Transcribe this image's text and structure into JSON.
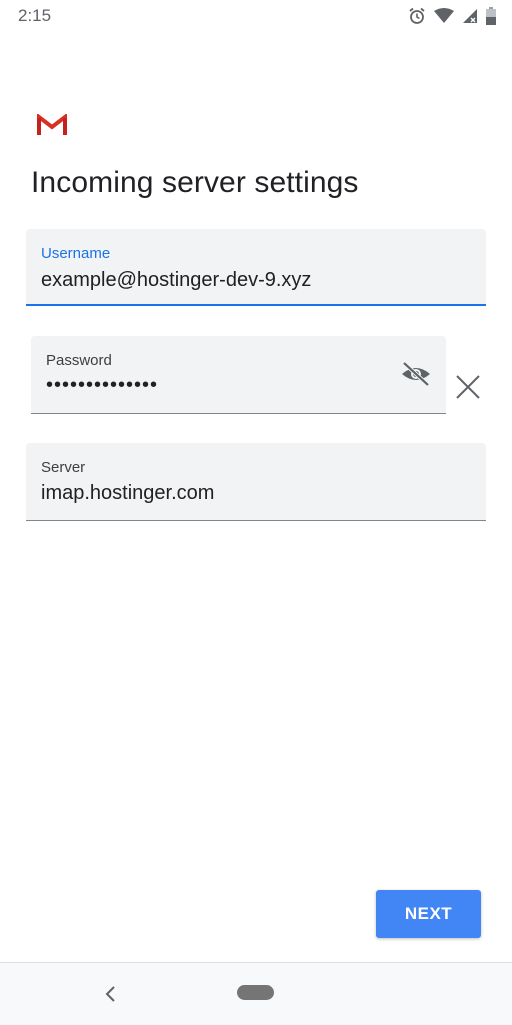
{
  "status_bar": {
    "time": "2:15",
    "icons": [
      "alarm-icon",
      "wifi-icon",
      "signal-icon",
      "battery-icon"
    ]
  },
  "app": {
    "logo_icon": "gmail-logo",
    "title": "Incoming server settings"
  },
  "form": {
    "username": {
      "label": "Username",
      "value": "example@hostinger-dev-9.xyz"
    },
    "password": {
      "label": "Password",
      "value": "••••••••••••••",
      "toggle_icon": "visibility-off-icon"
    },
    "server": {
      "label": "Server",
      "value": "imap.hostinger.com"
    }
  },
  "actions": {
    "next_label": "NEXT"
  },
  "colors": {
    "accent": "#1a73e8",
    "button": "#4285f4",
    "field_bg": "#f1f3f4"
  },
  "nav_bar": {
    "icons": [
      "back-icon",
      "home-pill-icon"
    ]
  }
}
